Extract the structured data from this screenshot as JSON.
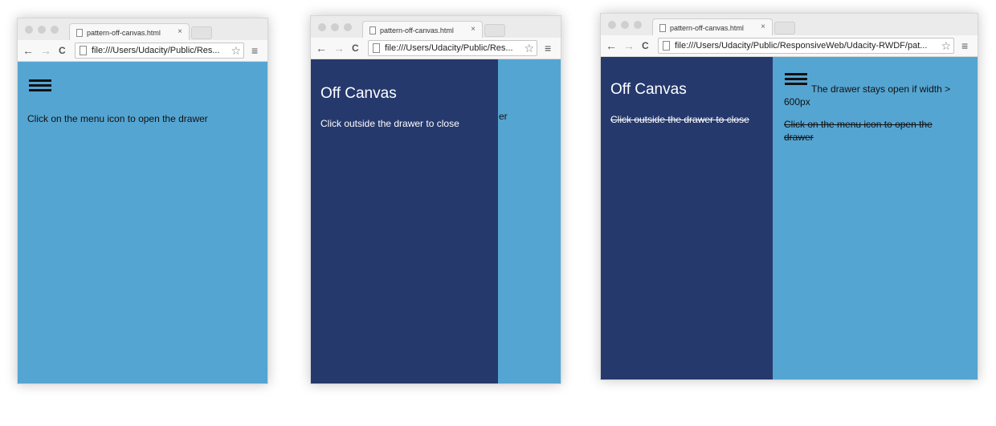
{
  "browser": {
    "tab_title": "pattern-off-canvas.html",
    "tab_close": "×",
    "star_glyph": "☆",
    "menu_glyph": "≡",
    "back_glyph": "←",
    "forward_glyph": "→",
    "reload_glyph": "C",
    "url_short": "file:///Users/Udacity/Public/Res...",
    "url_long": "file:///Users/Udacity/Public/ResponsiveWeb/Udacity-RWDF/pat..."
  },
  "screen1": {
    "instruction": "Click on the menu icon to open the drawer"
  },
  "screen2": {
    "drawer_title": "Off Canvas",
    "drawer_text": "Click outside the drawer to close",
    "peek_text": "er"
  },
  "screen3": {
    "drawer_title": "Off Canvas",
    "drawer_text": "Click outside the drawer to close",
    "note": "The drawer stays open if width > 600px",
    "instruction": "Click on the menu icon to open the drawer"
  },
  "colors": {
    "page_bg": "#55a5d2",
    "drawer_bg": "#26396d"
  }
}
